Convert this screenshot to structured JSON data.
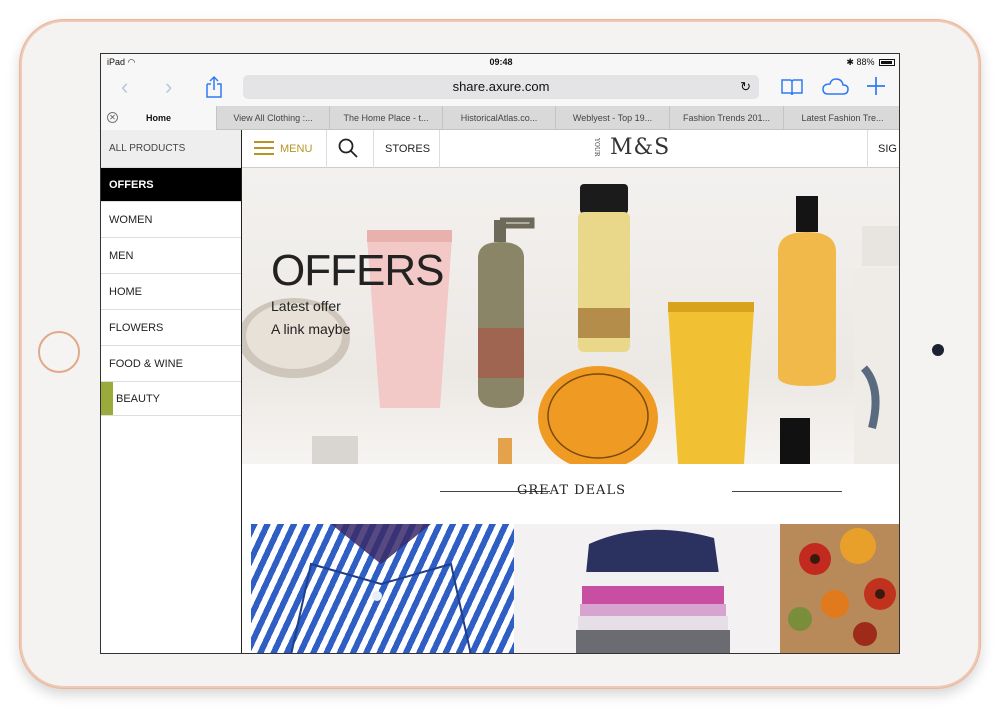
{
  "status_bar": {
    "device": "iPad",
    "time": "09:48",
    "battery": "88%"
  },
  "browser": {
    "url": "share.axure.com",
    "tabs": [
      {
        "label": "Home"
      },
      {
        "label": "View All Clothing :..."
      },
      {
        "label": "The Home Place - t..."
      },
      {
        "label": "HistoricalAtlas.co..."
      },
      {
        "label": "Weblyest - Top 19..."
      },
      {
        "label": "Fashion Trends 201..."
      },
      {
        "label": "Latest Fashion Tre..."
      }
    ]
  },
  "sidebar": {
    "header": "ALL PRODUCTS",
    "items": [
      {
        "label": "OFFERS"
      },
      {
        "label": "WOMEN"
      },
      {
        "label": "MEN"
      },
      {
        "label": "HOME"
      },
      {
        "label": "FLOWERS"
      },
      {
        "label": "FOOD & WINE"
      },
      {
        "label": "BEAUTY"
      }
    ]
  },
  "nav": {
    "menu": "MENU",
    "stores": "STORES",
    "logo_prefix": "YOUR",
    "logo": "M&S",
    "sign": "SIG"
  },
  "hero": {
    "title": "OFFERS",
    "line1": "Latest offer",
    "line2": "A link maybe"
  },
  "deals": {
    "title": "GREAT DEALS"
  },
  "colors": {
    "accent_gold": "#b59525",
    "beauty_green": "#9aab3c",
    "ios_blue": "#2f7af5",
    "frame_rose_gold": "#efc9b4"
  }
}
